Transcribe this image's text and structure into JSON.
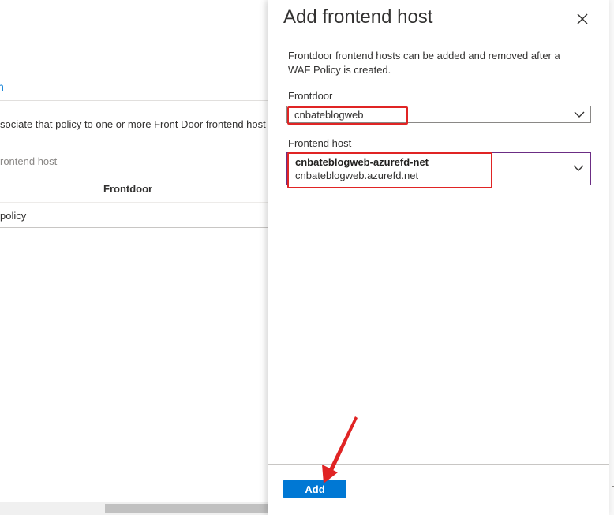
{
  "background_page": {
    "link_fragment": "n",
    "description": "sociate that policy to one or more Front Door frontend host",
    "section_label": "rontend host",
    "table": {
      "header_frontdoor": "Frontdoor",
      "row_cell": "policy"
    }
  },
  "panel": {
    "title": "Add frontend host",
    "description": "Frontdoor frontend hosts can be added and removed after a WAF Policy is created.",
    "frontdoor": {
      "label": "Frontdoor",
      "value": "cnbateblogweb"
    },
    "frontend_host": {
      "label": "Frontend host",
      "name": "cnbateblogweb-azurefd-net",
      "host": "cnbateblogweb.azurefd.net"
    },
    "add_button_label": "Add"
  },
  "icons": {
    "close": "close-icon",
    "chevron": "chevron-down-icon"
  },
  "colors": {
    "accent": "#0078d4",
    "annotation_red": "#e02424",
    "focus_border": "#6b2d84"
  }
}
